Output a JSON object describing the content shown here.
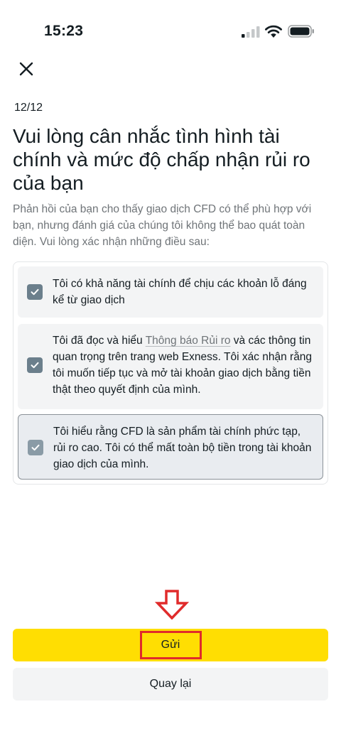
{
  "status_bar": {
    "time": "15:23",
    "icons": [
      "signal-icon",
      "wifi-icon",
      "battery-icon"
    ]
  },
  "header": {
    "close_icon": "close-icon",
    "step": "12/12"
  },
  "main": {
    "title": "Vui lòng cân nhắc tình hình tài chính và mức độ chấp nhận rủi ro của bạn",
    "description": "Phản hồi của bạn cho thấy giao dịch CFD có thể phù hợp với bạn, nhưng đánh giá của chúng tôi không thể bao quát toàn diện. Vui lòng xác nhận những điều sau:",
    "confirmations": [
      {
        "checked": true,
        "text": "Tôi có khả năng tài chính để chịu các khoản lỗ đáng kể từ giao dịch"
      },
      {
        "checked": true,
        "text_before": "Tôi đã đọc và hiểu ",
        "link_text": "Thông báo Rủi ro",
        "text_after": " và các thông tin quan trọng trên trang web Exness. Tôi xác nhận rằng tôi muốn tiếp tục và mở tài khoản giao dịch bằng tiền thật theo quyết định của mình."
      },
      {
        "checked": true,
        "text": "Tôi hiểu rằng CFD là sản phẩm tài chính phức tạp, rủi ro cao. Tôi có thể mất toàn bộ tiền trong tài khoản giao dịch của mình."
      }
    ]
  },
  "footer": {
    "submit_label": "Gửi",
    "back_label": "Quay lại"
  },
  "colors": {
    "accent": "#ffde02",
    "checkbox": "#6b7f8c",
    "highlight": "#e02b2b"
  }
}
